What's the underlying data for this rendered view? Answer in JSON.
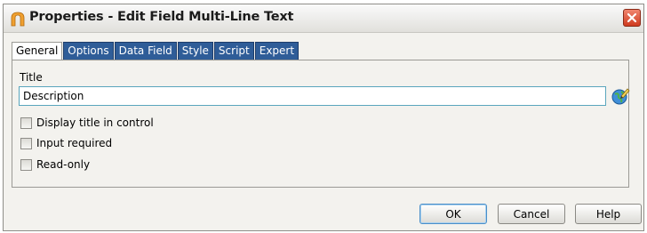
{
  "window": {
    "title": "Properties - Edit Field Multi-Line Text"
  },
  "tabs": [
    {
      "label": "General",
      "active": true
    },
    {
      "label": "Options",
      "active": false
    },
    {
      "label": "Data Field",
      "active": false
    },
    {
      "label": "Style",
      "active": false
    },
    {
      "label": "Script",
      "active": false
    },
    {
      "label": "Expert",
      "active": false
    }
  ],
  "general": {
    "title_label": "Title",
    "title_value": "Description",
    "checkboxes": [
      {
        "label": "Display title in control",
        "checked": false
      },
      {
        "label": "Input required",
        "checked": false
      },
      {
        "label": "Read-only",
        "checked": false
      }
    ]
  },
  "buttons": {
    "ok": "OK",
    "cancel": "Cancel",
    "help": "Help"
  },
  "colors": {
    "tab_inactive": "#2f5d98",
    "input_border": "#5aa6bd",
    "close_button": "#cf3b1f",
    "app_icon": "#f0a030"
  }
}
